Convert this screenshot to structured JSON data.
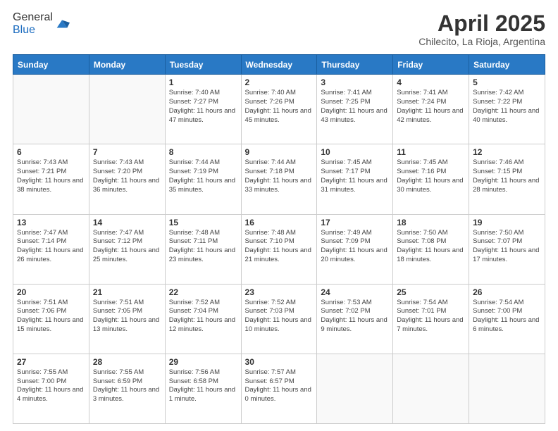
{
  "logo": {
    "general": "General",
    "blue": "Blue"
  },
  "header": {
    "month_year": "April 2025",
    "location": "Chilecito, La Rioja, Argentina"
  },
  "weekdays": [
    "Sunday",
    "Monday",
    "Tuesday",
    "Wednesday",
    "Thursday",
    "Friday",
    "Saturday"
  ],
  "weeks": [
    [
      {
        "day": "",
        "info": ""
      },
      {
        "day": "",
        "info": ""
      },
      {
        "day": "1",
        "info": "Sunrise: 7:40 AM\nSunset: 7:27 PM\nDaylight: 11 hours and 47 minutes."
      },
      {
        "day": "2",
        "info": "Sunrise: 7:40 AM\nSunset: 7:26 PM\nDaylight: 11 hours and 45 minutes."
      },
      {
        "day": "3",
        "info": "Sunrise: 7:41 AM\nSunset: 7:25 PM\nDaylight: 11 hours and 43 minutes."
      },
      {
        "day": "4",
        "info": "Sunrise: 7:41 AM\nSunset: 7:24 PM\nDaylight: 11 hours and 42 minutes."
      },
      {
        "day": "5",
        "info": "Sunrise: 7:42 AM\nSunset: 7:22 PM\nDaylight: 11 hours and 40 minutes."
      }
    ],
    [
      {
        "day": "6",
        "info": "Sunrise: 7:43 AM\nSunset: 7:21 PM\nDaylight: 11 hours and 38 minutes."
      },
      {
        "day": "7",
        "info": "Sunrise: 7:43 AM\nSunset: 7:20 PM\nDaylight: 11 hours and 36 minutes."
      },
      {
        "day": "8",
        "info": "Sunrise: 7:44 AM\nSunset: 7:19 PM\nDaylight: 11 hours and 35 minutes."
      },
      {
        "day": "9",
        "info": "Sunrise: 7:44 AM\nSunset: 7:18 PM\nDaylight: 11 hours and 33 minutes."
      },
      {
        "day": "10",
        "info": "Sunrise: 7:45 AM\nSunset: 7:17 PM\nDaylight: 11 hours and 31 minutes."
      },
      {
        "day": "11",
        "info": "Sunrise: 7:45 AM\nSunset: 7:16 PM\nDaylight: 11 hours and 30 minutes."
      },
      {
        "day": "12",
        "info": "Sunrise: 7:46 AM\nSunset: 7:15 PM\nDaylight: 11 hours and 28 minutes."
      }
    ],
    [
      {
        "day": "13",
        "info": "Sunrise: 7:47 AM\nSunset: 7:14 PM\nDaylight: 11 hours and 26 minutes."
      },
      {
        "day": "14",
        "info": "Sunrise: 7:47 AM\nSunset: 7:12 PM\nDaylight: 11 hours and 25 minutes."
      },
      {
        "day": "15",
        "info": "Sunrise: 7:48 AM\nSunset: 7:11 PM\nDaylight: 11 hours and 23 minutes."
      },
      {
        "day": "16",
        "info": "Sunrise: 7:48 AM\nSunset: 7:10 PM\nDaylight: 11 hours and 21 minutes."
      },
      {
        "day": "17",
        "info": "Sunrise: 7:49 AM\nSunset: 7:09 PM\nDaylight: 11 hours and 20 minutes."
      },
      {
        "day": "18",
        "info": "Sunrise: 7:50 AM\nSunset: 7:08 PM\nDaylight: 11 hours and 18 minutes."
      },
      {
        "day": "19",
        "info": "Sunrise: 7:50 AM\nSunset: 7:07 PM\nDaylight: 11 hours and 17 minutes."
      }
    ],
    [
      {
        "day": "20",
        "info": "Sunrise: 7:51 AM\nSunset: 7:06 PM\nDaylight: 11 hours and 15 minutes."
      },
      {
        "day": "21",
        "info": "Sunrise: 7:51 AM\nSunset: 7:05 PM\nDaylight: 11 hours and 13 minutes."
      },
      {
        "day": "22",
        "info": "Sunrise: 7:52 AM\nSunset: 7:04 PM\nDaylight: 11 hours and 12 minutes."
      },
      {
        "day": "23",
        "info": "Sunrise: 7:52 AM\nSunset: 7:03 PM\nDaylight: 11 hours and 10 minutes."
      },
      {
        "day": "24",
        "info": "Sunrise: 7:53 AM\nSunset: 7:02 PM\nDaylight: 11 hours and 9 minutes."
      },
      {
        "day": "25",
        "info": "Sunrise: 7:54 AM\nSunset: 7:01 PM\nDaylight: 11 hours and 7 minutes."
      },
      {
        "day": "26",
        "info": "Sunrise: 7:54 AM\nSunset: 7:00 PM\nDaylight: 11 hours and 6 minutes."
      }
    ],
    [
      {
        "day": "27",
        "info": "Sunrise: 7:55 AM\nSunset: 7:00 PM\nDaylight: 11 hours and 4 minutes."
      },
      {
        "day": "28",
        "info": "Sunrise: 7:55 AM\nSunset: 6:59 PM\nDaylight: 11 hours and 3 minutes."
      },
      {
        "day": "29",
        "info": "Sunrise: 7:56 AM\nSunset: 6:58 PM\nDaylight: 11 hours and 1 minute."
      },
      {
        "day": "30",
        "info": "Sunrise: 7:57 AM\nSunset: 6:57 PM\nDaylight: 11 hours and 0 minutes."
      },
      {
        "day": "",
        "info": ""
      },
      {
        "day": "",
        "info": ""
      },
      {
        "day": "",
        "info": ""
      }
    ]
  ]
}
